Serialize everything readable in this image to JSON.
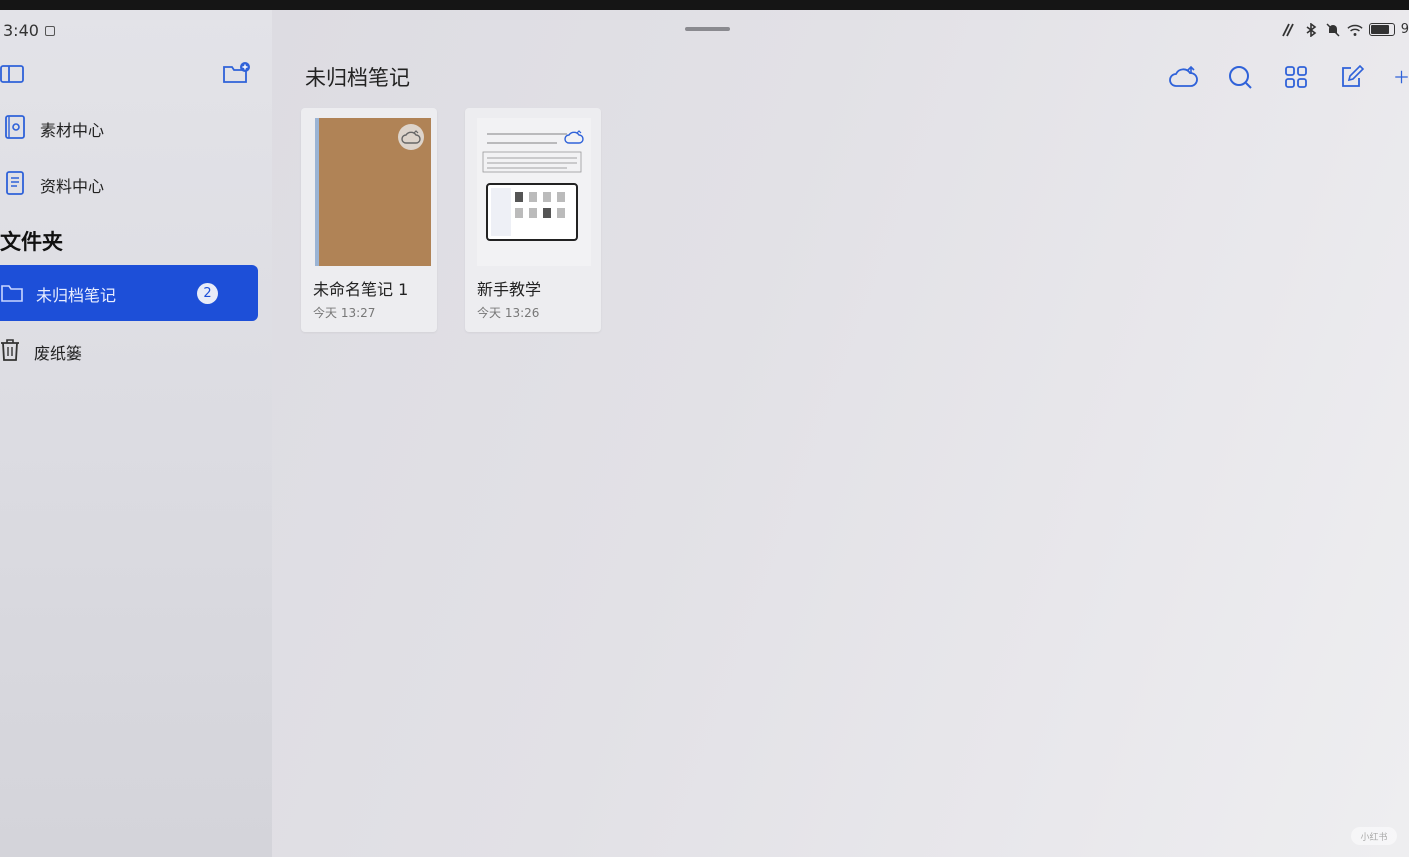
{
  "status_bar": {
    "time": "3:40",
    "battery_label": "9"
  },
  "sidebar": {
    "items": [
      {
        "label": "素材中心",
        "icon": "material-center-icon"
      },
      {
        "label": "资料中心",
        "icon": "document-center-icon"
      }
    ],
    "folders_title": "文件夹",
    "folders": [
      {
        "label": "未归档笔记",
        "count": "2",
        "selected": true,
        "icon": "folder-icon"
      },
      {
        "label": "废纸篓",
        "selected": false,
        "icon": "trash-icon"
      }
    ]
  },
  "main": {
    "title": "未归档笔记",
    "notes": [
      {
        "name": "未命名笔记 1",
        "time": "今天 13:27",
        "cover_color": "#b08356"
      },
      {
        "name": "新手教学",
        "time": "今天 13:26"
      }
    ]
  },
  "watermark": "小红书",
  "colors": {
    "accent": "#1d4fd8",
    "toolbar_icon": "#2f62d9"
  }
}
